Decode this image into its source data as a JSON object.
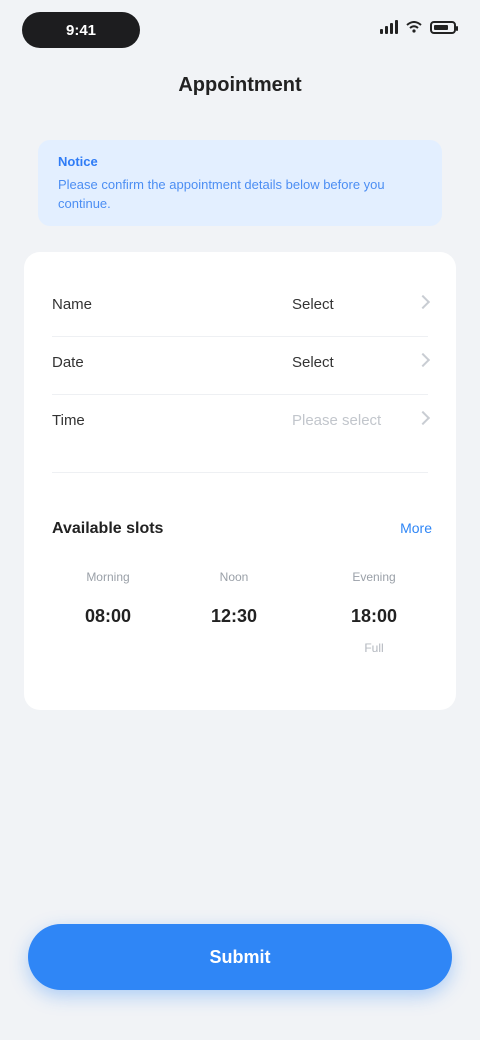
{
  "status_bar": {
    "time": "9:41"
  },
  "nav": {
    "title": "Appointment"
  },
  "notice": {
    "title": "Notice",
    "text": "Please confirm the appointment details below before you continue."
  },
  "form": {
    "rows": [
      {
        "label": "Name",
        "value": "Select",
        "placeholder": false
      },
      {
        "label": "Date",
        "value": "Select",
        "placeholder": false
      },
      {
        "label": "Time",
        "value": "Please select",
        "placeholder": true
      }
    ]
  },
  "section": {
    "title": "Available slots",
    "link": "More",
    "stats": [
      {
        "label": "Morning",
        "value": "08:00",
        "sub": ""
      },
      {
        "label": "Noon",
        "value": "12:30",
        "sub": ""
      },
      {
        "label": "Evening",
        "value": "18:00",
        "sub": "Full"
      }
    ]
  },
  "submit_button": {
    "label": "Submit"
  }
}
